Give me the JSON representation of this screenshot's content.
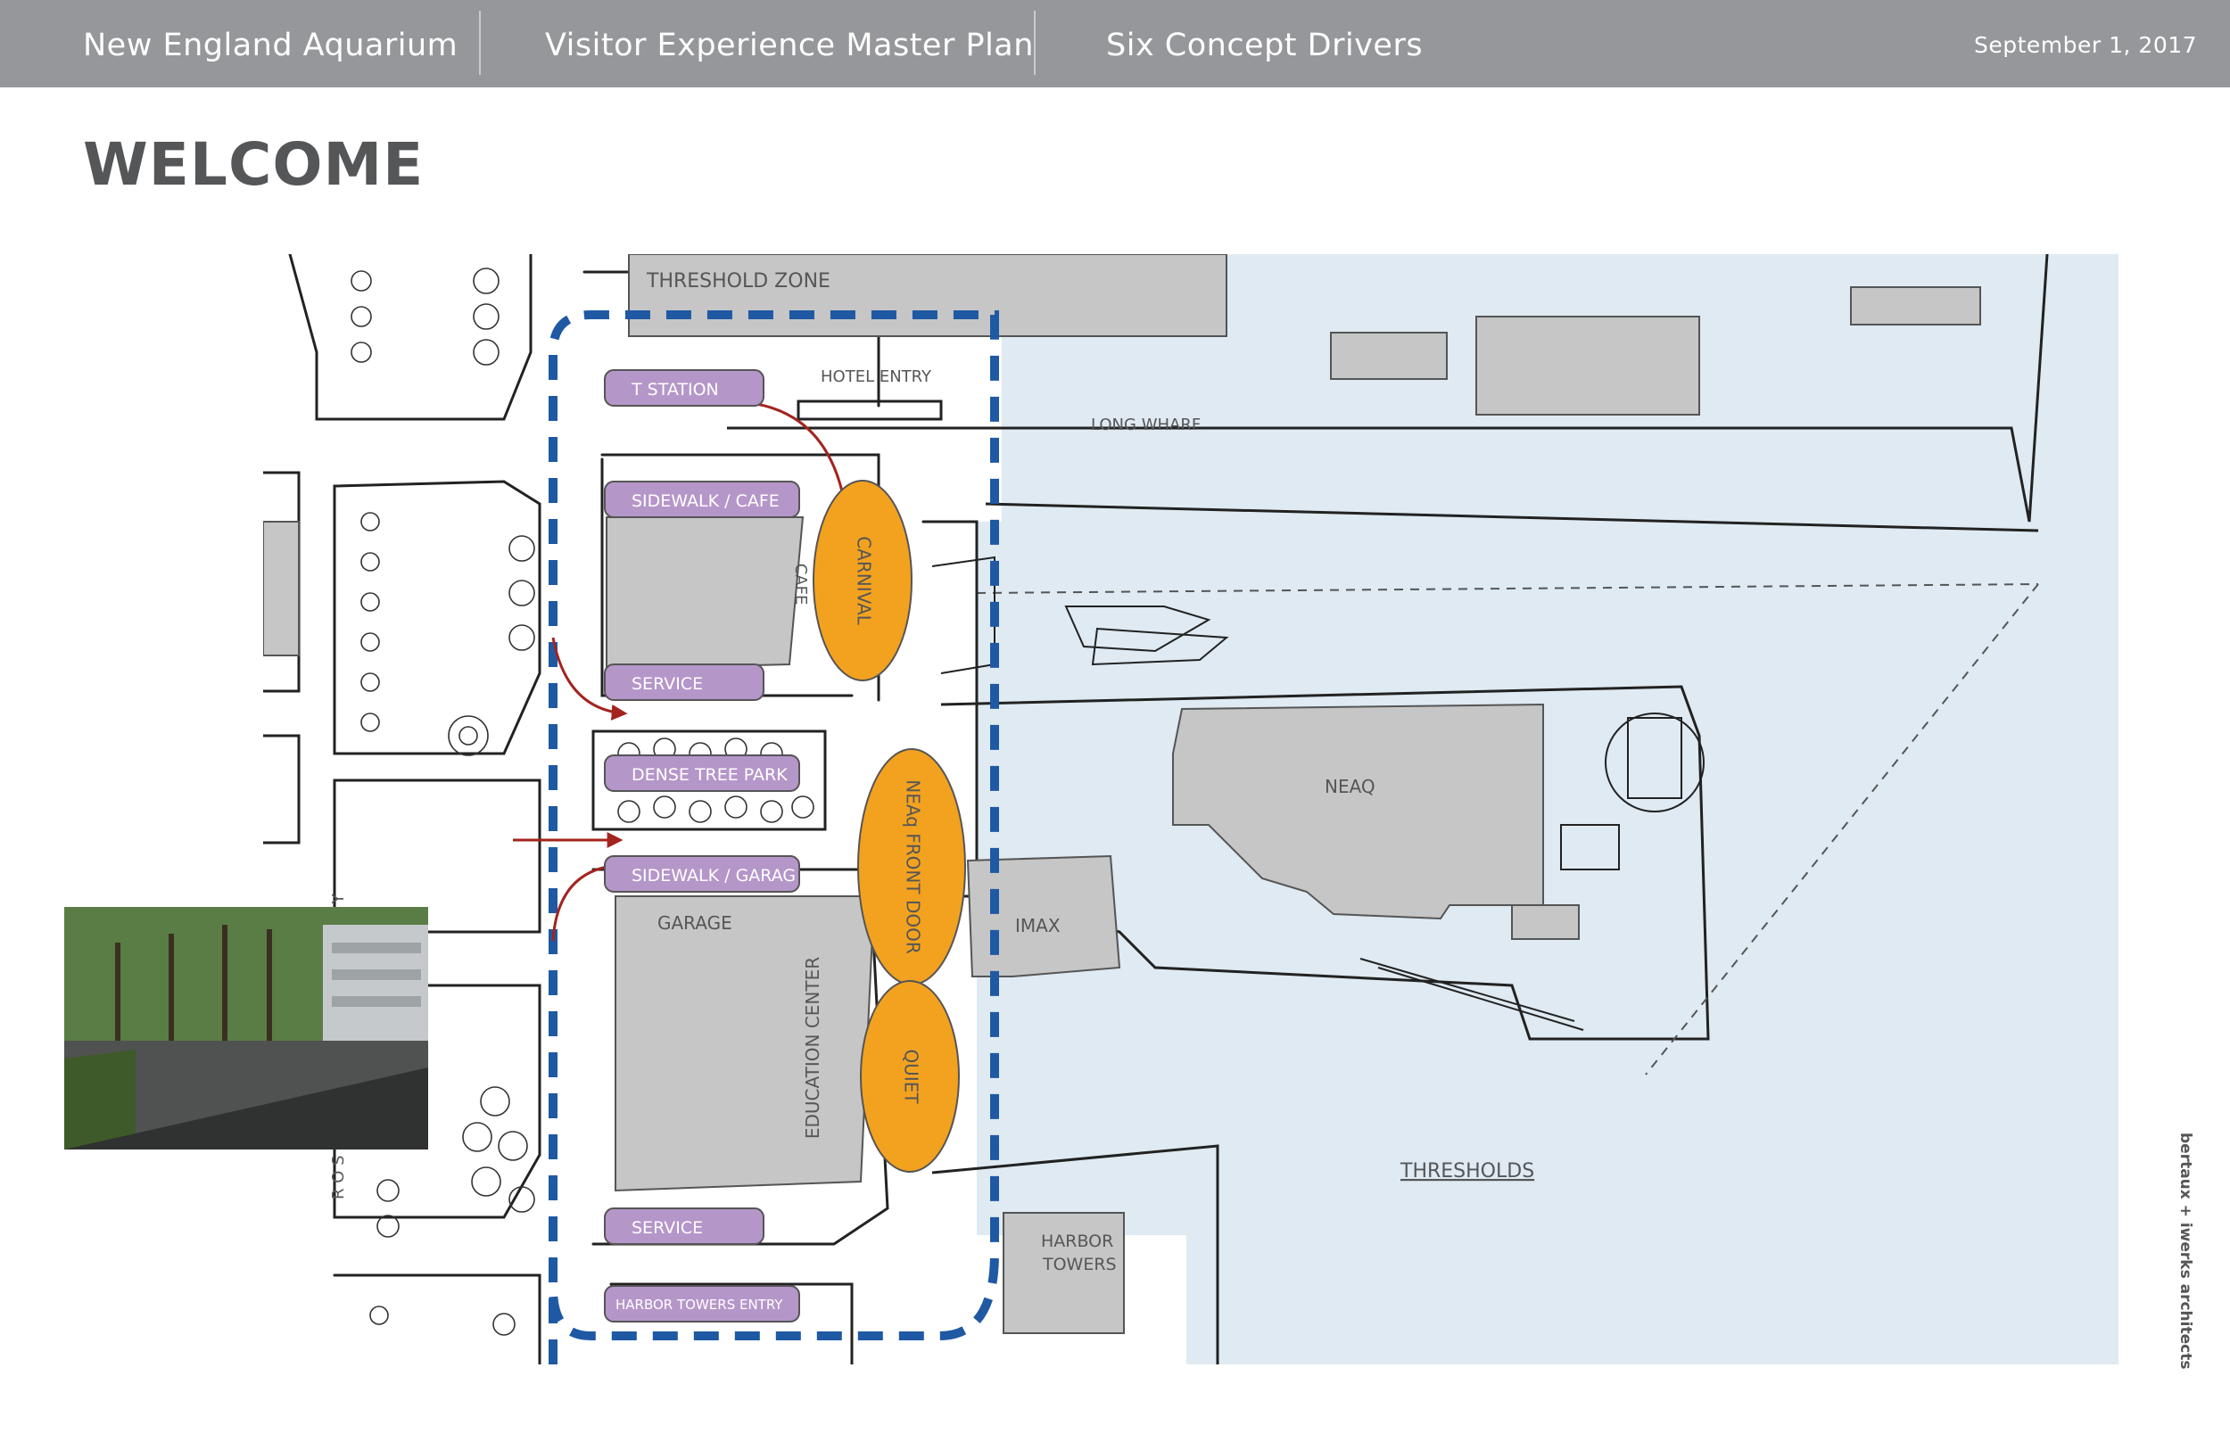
{
  "header": {
    "org": "New England Aquarium",
    "project": "Visitor Experience Master Plan",
    "section": "Six Concept Drivers",
    "date": "September 1, 2017"
  },
  "page": {
    "title": "WELCOME"
  },
  "site_plan": {
    "area_labels": {
      "threshold_zone": "THRESHOLD ZONE",
      "hotel_entry": "HOTEL ENTRY",
      "long_wharf": "LONG WHARF",
      "greenway": "R O S E   K E N N E D Y   G R E E N W A Y",
      "cafe": "CAFE",
      "neaq": "NEAQ",
      "imax": "IMAX",
      "garage": "GARAGE",
      "education_center": "EDUCATION CENTER",
      "harbor_towers_line1": "HARBOR",
      "harbor_towers_line2": "TOWERS",
      "thresholds": "THRESHOLDS"
    },
    "tags": [
      "T STATION",
      "SIDEWALK / CAFE",
      "SERVICE",
      "DENSE TREE PARK",
      "SIDEWALK / GARAG",
      "SERVICE",
      "HARBOR TOWERS ENTRY"
    ],
    "zones": [
      "CARNIVAL",
      "NEAq FRONT DOOR",
      "QUIET"
    ],
    "colors": {
      "water": "#dfeaf2",
      "building": "#c6c6c6",
      "tag": "#b596c9",
      "zone": "#f3a21f",
      "threshold_dash": "#1f59a3",
      "arrow": "#a3241f"
    }
  },
  "credit": "bertaux + iwerks architects"
}
